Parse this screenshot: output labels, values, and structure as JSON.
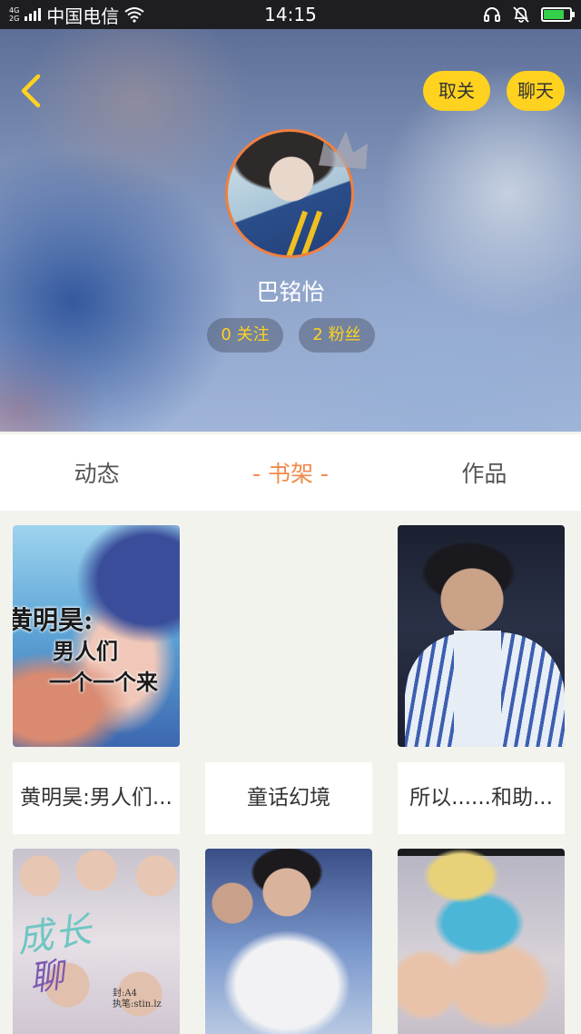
{
  "status_bar": {
    "network_type": "4G 2G",
    "carrier": "中国电信",
    "time": "14:15",
    "battery_level": 0.8,
    "battery_color": "#35d04a",
    "icons": [
      "signal-icon",
      "wifi-icon",
      "headset-icon",
      "mute-icon",
      "battery-icon"
    ]
  },
  "header": {
    "back_icon": "chevron-left-icon",
    "unfollow_label": "取关",
    "chat_label": "聊天",
    "username": "巴铭怡",
    "following": "0 关注",
    "fans": "2 粉丝",
    "accent_color": "#ffd21f",
    "avatar_ring_color": "#f08040"
  },
  "tabs": {
    "items": [
      "动态",
      "- 书架 -",
      "作品"
    ],
    "active_index": 1,
    "active_color": "#f08a4a"
  },
  "bookshelf": {
    "items": [
      {
        "title": "黄明昊:男人们...",
        "cover_text_lines": [
          "黄明昊:",
          "男人们",
          "一个一个来"
        ]
      },
      {
        "title": "童话幻境"
      },
      {
        "title": "所以......和助..."
      },
      {
        "title": "",
        "cover_text_lines": [
          "成长",
          "聊"
        ],
        "cover_credits": [
          "封:A4",
          "执笔:stin.lz"
        ]
      },
      {
        "title": ""
      },
      {
        "title": ""
      }
    ]
  }
}
